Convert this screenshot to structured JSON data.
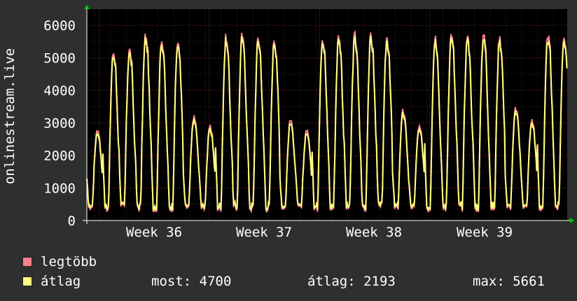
{
  "chart_data": {
    "type": "line",
    "ylabel": "onlinestream.live",
    "ylim": [
      0,
      6500
    ],
    "y_ticks": [
      0,
      1000,
      2000,
      3000,
      4000,
      5000,
      6000
    ],
    "x_ticks": [
      "Week 36",
      "Week 37",
      "Week 38",
      "Week 39"
    ],
    "grid": true,
    "colors": {
      "legtobb": "#ff7f8f",
      "atlag": "#ffff80",
      "background": "#000000",
      "grid": "#6a2a2a"
    },
    "series": [
      {
        "name": "legtöbb",
        "daily_peaks": [
          2800,
          5200,
          5300,
          5700,
          5600,
          5500,
          3200,
          2900,
          5650,
          5700,
          5650,
          5600,
          3100,
          2800,
          5650,
          5700,
          5750,
          5700,
          5650,
          3400,
          2900,
          5700,
          5750,
          5700,
          5800,
          5650,
          3450,
          3100,
          5750,
          5700
        ],
        "daily_min": 400
      },
      {
        "name": "átlag",
        "daily_peaks": [
          2700,
          5100,
          5200,
          5600,
          5500,
          5400,
          3100,
          2800,
          5550,
          5600,
          5550,
          5500,
          3000,
          2700,
          5550,
          5600,
          5600,
          5600,
          5550,
          3300,
          2800,
          5600,
          5650,
          5600,
          5650,
          5550,
          3350,
          3000,
          5600,
          5600
        ],
        "daily_min": 450
      }
    ]
  },
  "legend": {
    "items": [
      {
        "label": "legtöbb",
        "color": "#ff7f8f"
      },
      {
        "label": "átlag",
        "color": "#ffff80"
      }
    ],
    "stats": {
      "now": "most: 4700",
      "avg": "átlag: 2193",
      "max": "max: 5661"
    }
  }
}
